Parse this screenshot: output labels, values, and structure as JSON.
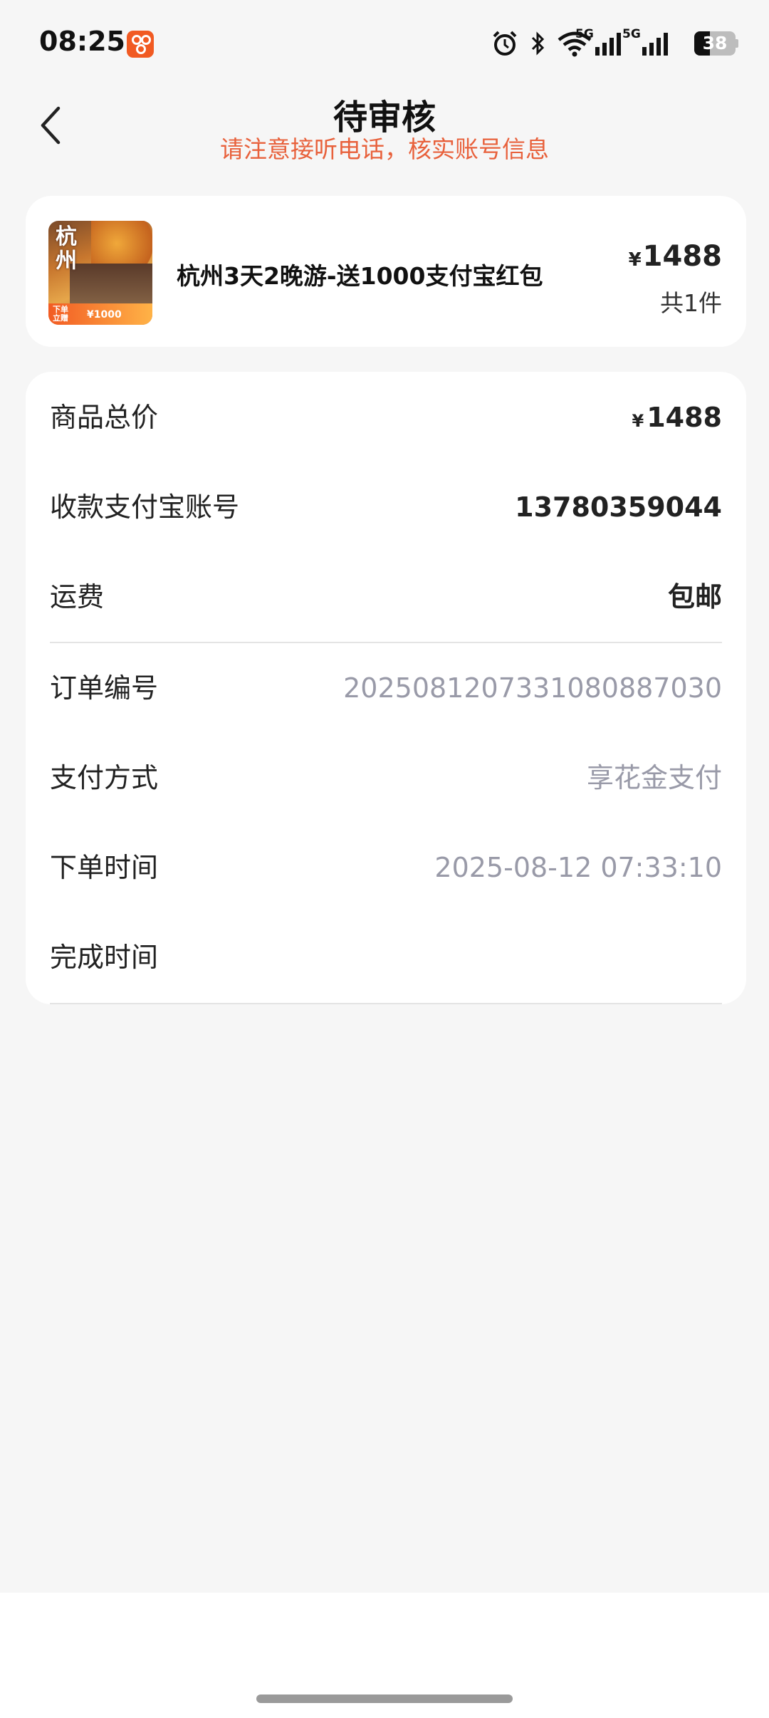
{
  "status_bar": {
    "time": "08:25",
    "battery_level": "38",
    "network_label_1": "5G",
    "network_label_2": "5G"
  },
  "header": {
    "title": "待审核",
    "subtitle": "请注意接听电话，核实账号信息"
  },
  "product": {
    "thumbnail_text": "杭州",
    "thumbnail_badge": "下单立赠",
    "thumbnail_offer": "¥1000",
    "name": "杭州3天2晚游-送1000支付宝红包",
    "currency": "¥",
    "price": "1488",
    "quantity": "共1件"
  },
  "details": {
    "total_label": "商品总价",
    "total_currency": "¥",
    "total_value": "1488",
    "alipay_label": "收款支付宝账号",
    "alipay_value": "13780359044",
    "shipping_label": "运费",
    "shipping_value": "包邮",
    "order_no_label": "订单编号",
    "order_no_value": "20250812073310808870 30",
    "pay_method_label": "支付方式",
    "pay_method_value": "享花金支付",
    "order_time_label": "下单时间",
    "order_time_value": "2025-08-12 07:33:10",
    "finish_time_label": "完成时间",
    "finish_time_value": ""
  },
  "colors": {
    "accent": "#e8613c",
    "muted_text": "#999aa8",
    "background": "#f6f6f6"
  }
}
